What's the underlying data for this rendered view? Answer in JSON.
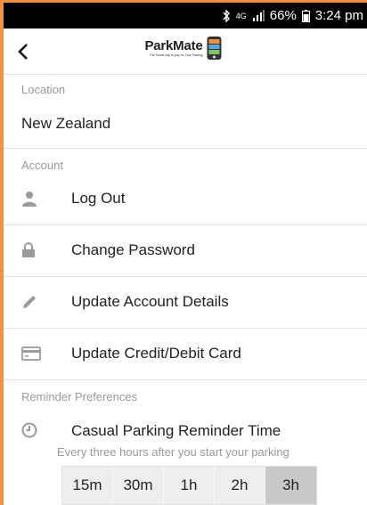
{
  "status_bar": {
    "bluetooth_icon": "bluetooth-icon",
    "network": "4G",
    "battery": "66%",
    "time": "3:24 pm"
  },
  "app_bar": {
    "back_icon": "chevron-left-icon",
    "logo_name": "ParkMate",
    "logo_tagline": "The Smart way to pay for Your Parking"
  },
  "location": {
    "section_label": "Location",
    "value": "New Zealand"
  },
  "account": {
    "section_label": "Account",
    "items": [
      {
        "icon": "user-icon",
        "label": "Log Out"
      },
      {
        "icon": "lock-icon",
        "label": "Change Password"
      },
      {
        "icon": "pencil-icon",
        "label": "Update Account Details"
      },
      {
        "icon": "credit-card-icon",
        "label": "Update Credit/Debit Card"
      }
    ]
  },
  "reminder": {
    "section_label": "Reminder Preferences",
    "icon": "clock-icon",
    "title": "Casual Parking Reminder Time",
    "subtitle": "Every three hours after you start your parking",
    "options": [
      "15m",
      "30m",
      "1h",
      "2h",
      "3h"
    ],
    "selected": "3h"
  },
  "colors": {
    "accent_frame": "#f2913f",
    "selected_segment": "#c8c8c8"
  }
}
